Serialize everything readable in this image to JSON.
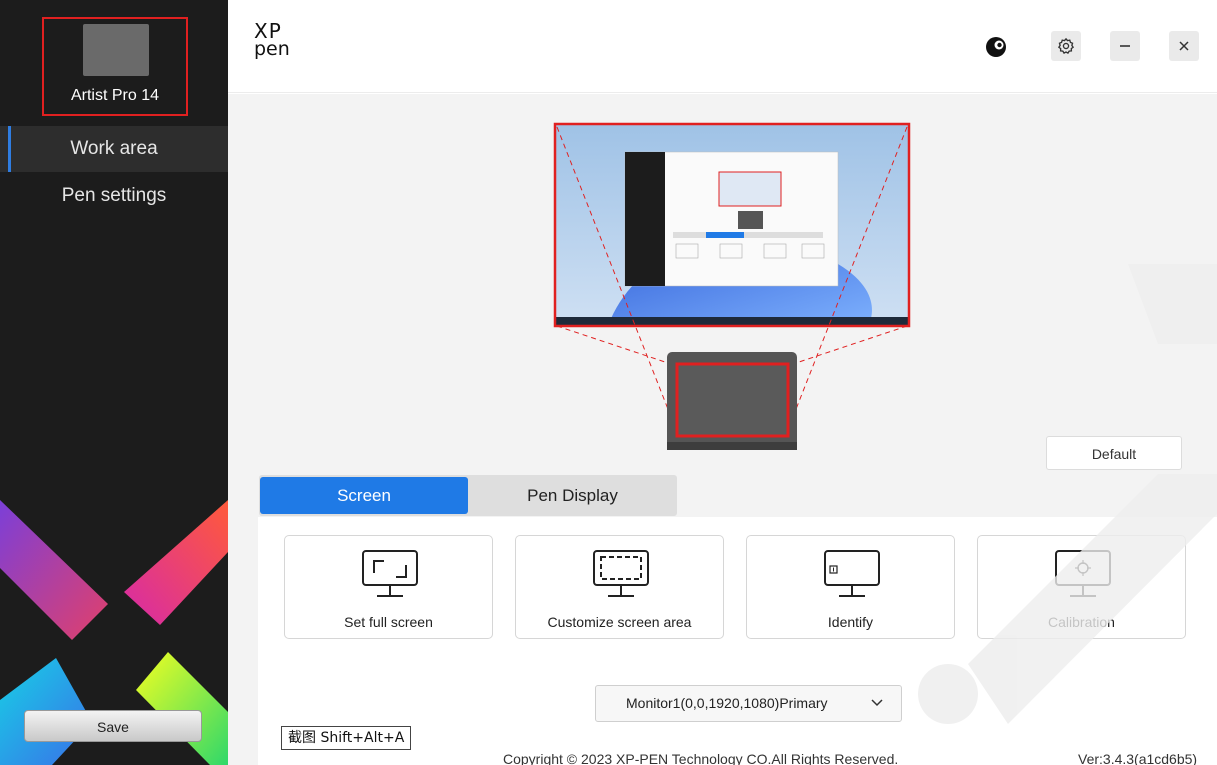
{
  "sidebar": {
    "device_name": "Artist Pro 14",
    "nav": [
      {
        "label": "Work area",
        "active": true
      },
      {
        "label": "Pen settings",
        "active": false
      }
    ],
    "save_label": "Save"
  },
  "header": {
    "logo_line1": "XP",
    "logo_line2": "pen",
    "icons": [
      "brand-icon",
      "gear-icon",
      "minimize-icon",
      "close-icon"
    ]
  },
  "work_area": {
    "default_label": "Default",
    "tabs": [
      {
        "label": "Screen",
        "active": true
      },
      {
        "label": "Pen Display",
        "active": false
      }
    ],
    "actions": [
      {
        "label": "Set full screen",
        "icon": "full-screen-monitor-icon"
      },
      {
        "label": "Customize screen area",
        "icon": "custom-area-monitor-icon"
      },
      {
        "label": "Identify",
        "icon": "identify-monitor-icon"
      },
      {
        "label": "Calibration",
        "icon": "calibration-monitor-icon"
      }
    ],
    "monitor_select": "Monitor1(0,0,1920,1080)Primary"
  },
  "footer": {
    "screenshot_tip": "截图 Shift+Alt+A",
    "copyright": "Copyright © 2023  XP-PEN Technology CO.All Rights Reserved.",
    "version": "Ver:3.4.3(a1cd6b5)"
  },
  "colors": {
    "accent": "#1f7ae6",
    "highlight": "#e02020",
    "sidebar_bg": "#1c1c1c"
  }
}
